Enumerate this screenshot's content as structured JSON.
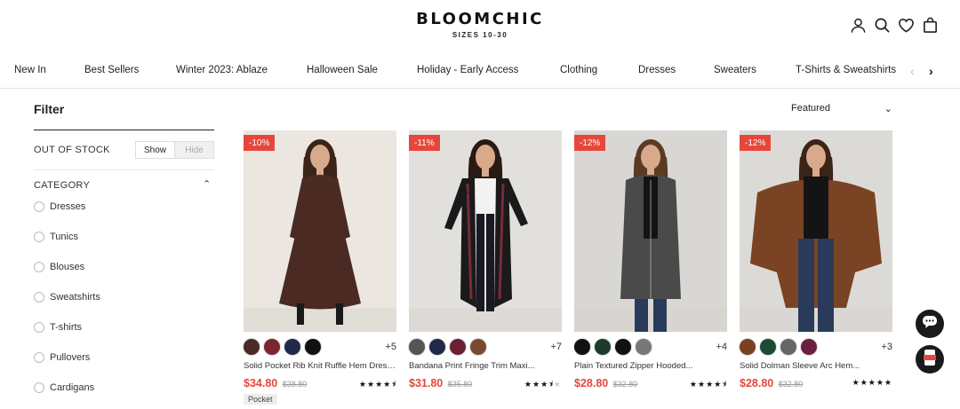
{
  "brand": {
    "name": "BLOOMCHIC",
    "tagline": "SIZES 10-30"
  },
  "header_icons": [
    "account-icon",
    "search-icon",
    "heart-icon",
    "bag-icon"
  ],
  "nav": {
    "items": [
      "New In",
      "Best Sellers",
      "Winter 2023: Ablaze",
      "Halloween Sale",
      "Holiday - Early Access",
      "Clothing",
      "Dresses",
      "Sweaters",
      "T-Shirts & Sweatshirts"
    ],
    "prev_icon": "chevron-left-icon",
    "next_icon": "chevron-right-icon"
  },
  "filter": {
    "title": "Filter",
    "out_of_stock": {
      "label": "OUT OF STOCK",
      "show": "Show",
      "hide": "Hide",
      "selected": "Show"
    },
    "category": {
      "label": "CATEGORY",
      "options": [
        "Dresses",
        "Tunics",
        "Blouses",
        "Sweatshirts",
        "T-shirts",
        "Pullovers",
        "Cardigans"
      ]
    }
  },
  "sort": {
    "selected": "Featured"
  },
  "products": [
    {
      "discount": "-10%",
      "name": "Solid Pocket Rib Knit Ruffle Hem Dress...",
      "price": "$34.80",
      "old_price": "$38.80",
      "rating": 4.5,
      "swatches": [
        "#4a2a22",
        "#7a2630",
        "#1f2a4a",
        "#111111"
      ],
      "more_colors": "+5",
      "tag": "Pocket",
      "image_colors": {
        "bg": "#ebe6e0",
        "outfit": "#4a2a22",
        "hair": "#3a241a"
      }
    },
    {
      "discount": "-11%",
      "name": "Bandana Print Fringe Trim Maxi...",
      "price": "$31.80",
      "old_price": "$35.80",
      "rating": 3.5,
      "swatches": [
        "#555555",
        "#1f2a4a",
        "#6a2030",
        "#7a4a30"
      ],
      "more_colors": "+7",
      "tag": "",
      "image_colors": {
        "bg": "#e2e0dd",
        "outfit": "#1a1a1a",
        "hair": "#2a1a14"
      }
    },
    {
      "discount": "-12%",
      "name": "Plain Textured Zipper Hooded...",
      "price": "$28.80",
      "old_price": "$32.80",
      "rating": 4.5,
      "swatches": [
        "#111111",
        "#1e3a2a",
        "#111111",
        "#777777"
      ],
      "more_colors": "+4",
      "tag": "",
      "image_colors": {
        "bg": "#d9d7d3",
        "outfit": "#4a4a4a",
        "hair": "#5a3a24"
      }
    },
    {
      "discount": "-12%",
      "name": "Solid Dolman Sleeve Arc Hem...",
      "price": "$28.80",
      "old_price": "$32.80",
      "rating": 5,
      "swatches": [
        "#7a4020",
        "#1e4a34",
        "#666666",
        "#6a2040"
      ],
      "more_colors": "+3",
      "tag": "",
      "image_colors": {
        "bg": "#dcdad6",
        "outfit": "#7a4424",
        "hair": "#3a2418"
      }
    }
  ],
  "floating": [
    "chat-icon",
    "coupon-icon"
  ]
}
